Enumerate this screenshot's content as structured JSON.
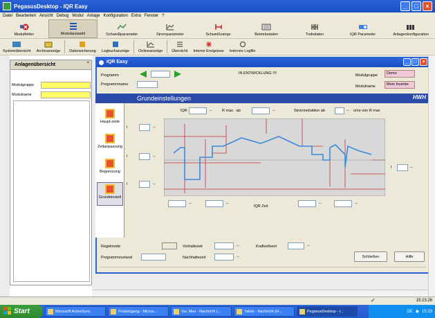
{
  "app": {
    "title": "PegasusDesktop - IQR Easy",
    "menu": [
      "Datei",
      "Bearbeiten",
      "Ansicht",
      "Debug",
      "Modul",
      "Anlage",
      "Konfiguration",
      "Extra",
      "Fenster",
      "?"
    ]
  },
  "toolbar1": [
    {
      "label": "Modulfehler",
      "icon": "module-error-icon"
    },
    {
      "label": "Modulauswahl",
      "icon": "module-select-icon",
      "active": true
    },
    {
      "label": "Schweißparameter",
      "icon": "weld-params-icon"
    },
    {
      "label": "Stromparameter",
      "icon": "current-params-icon"
    },
    {
      "label": "Schweißzange",
      "icon": "weld-gun-icon"
    },
    {
      "label": "Betriebsdaten",
      "icon": "operating-data-icon"
    },
    {
      "label": "Trafodaten",
      "icon": "transformer-icon"
    },
    {
      "label": "IQR Parameter",
      "icon": "iqr-params-icon"
    },
    {
      "label": "Anlagenkonfiguration",
      "icon": "plant-config-icon"
    }
  ],
  "toolbar2": [
    {
      "label": "Systemübersicht",
      "icon": "system-overview-icon"
    },
    {
      "label": "Archivanzeige",
      "icon": "archive-icon"
    },
    {
      "label": "Datensicherung",
      "icon": "backup-icon"
    },
    {
      "label": "Logbuchanzeige",
      "icon": "logbook-icon"
    },
    {
      "label": "Onlineanzeige",
      "icon": "online-display-icon"
    },
    {
      "label": "Übersicht",
      "icon": "overview-icon"
    },
    {
      "label": "Interne Ereignisse",
      "icon": "internal-events-icon"
    },
    {
      "label": "Internes Logfile",
      "icon": "internal-logfile-icon"
    }
  ],
  "left_panel": {
    "title": "Anlagenübersicht",
    "close": "×",
    "modulgruppe_label": "Modulgruppe",
    "modulname_label": "Modulname"
  },
  "dialog": {
    "title": "IQR Easy",
    "programm_label": "Programm",
    "programmname_label": "Programmname",
    "status": "IN ENTWICKLUNG !!!!",
    "modulgruppe_label": "Modulgruppe",
    "modulgruppe_value": "Demo",
    "modulname_label": "Modulname",
    "modulname_value": "Mein Inverter",
    "section_title": "Grundeinstellungen",
    "brand": "HWH",
    "sidebar": [
      "Haupt-zeite",
      "Zeitanpassung",
      "Begrenzung",
      "Grundeinstell"
    ],
    "iqr_label": "IQR",
    "rmax_label": "R max. -ab",
    "stromreduktion_label": "Stromreduktion ab",
    "promille_label": "o/oo von R max",
    "i_label": "I",
    "dash": "--",
    "iqr_zeit_label": "IQR Zeit",
    "regelmode_label": "Regelmode",
    "vorhaltezeit_label": "Vorhaltezeit",
    "kraftsollwert_label": "Kraftsollwert",
    "programmzustand_label": "Programmzustand",
    "nachhaltezeit_label": "Nachhaltezeit",
    "close_button": "Schließen",
    "help_button": "Hilfe"
  },
  "status": {
    "clock_small": "15:23:26"
  },
  "taskbar": {
    "start": "Start",
    "tasks": [
      "Microsoft ActiveSync",
      "Posteingang - Micros...",
      "Vw: Mex - Nachricht (...",
      "Tafeln - Nachricht (H...",
      "PegasusDesktop - I..."
    ],
    "lang": "DE",
    "clock": "15:23"
  },
  "colors": {
    "accent": "#2a62d8",
    "highlight": "#ffff66",
    "chart_line": "#3a8ad8",
    "chart_grid": "#c83030"
  }
}
